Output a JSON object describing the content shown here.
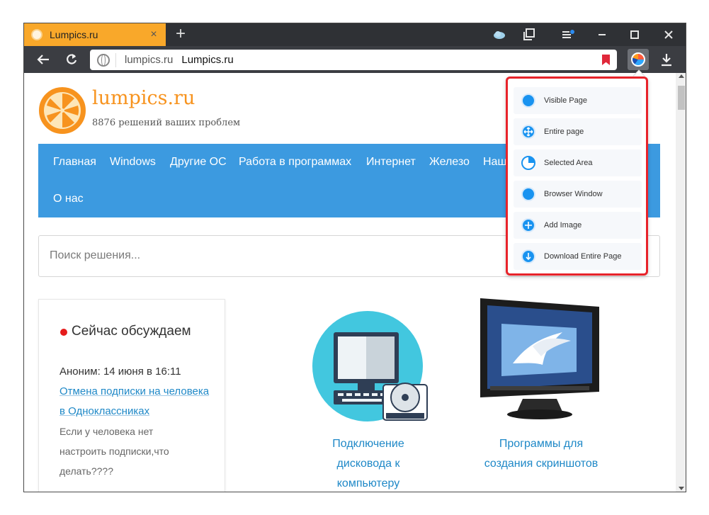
{
  "browser": {
    "tab_title": "Lumpics.ru",
    "tab_close": "×",
    "new_tab": "+",
    "omnibox_domain": "lumpics.ru",
    "omnibox_title": "Lumpics.ru"
  },
  "site": {
    "name": "lumpics.ru",
    "tagline": "8876 решений ваших проблем",
    "nav": [
      "Главная",
      "Windows",
      "Другие ОС",
      "Работа в программах",
      "Интернет",
      "Железо",
      "Наш",
      "О нас"
    ],
    "search_placeholder": "Поиск решения...",
    "discuss": {
      "title": "Сейчас обсуждаем",
      "meta": "Аноним: 14 июня в 16:11",
      "link_line1": "Отмена подписки на человека",
      "link_line2": "в Одноклассниках",
      "text_line1": "Если у человека нет",
      "text_line2": "настроить подписки,что",
      "text_line3": "делать????"
    },
    "articles": [
      {
        "line1": "Подключение",
        "line2": "дисковода к",
        "line3": "компьютеру"
      },
      {
        "line1": "Программы для",
        "line2": "создания скриншотов"
      }
    ]
  },
  "extension_menu": {
    "items": [
      {
        "label": "Visible Page",
        "icon": "circle-icon"
      },
      {
        "label": "Entire page",
        "icon": "move-arrows-icon"
      },
      {
        "label": "Selected Area",
        "icon": "crop-icon"
      },
      {
        "label": "Browser Window",
        "icon": "window-icon"
      },
      {
        "label": "Add Image",
        "icon": "plus-icon"
      },
      {
        "label": "Download Entire Page",
        "icon": "download-icon"
      }
    ]
  },
  "colors": {
    "tab_active": "#f9a82a",
    "nav_bg": "#3c9ae0",
    "link": "#1e88c7",
    "brand_orange": "#f7931e",
    "highlight_border": "#e8232a",
    "menu_icon": "#1993f0"
  }
}
